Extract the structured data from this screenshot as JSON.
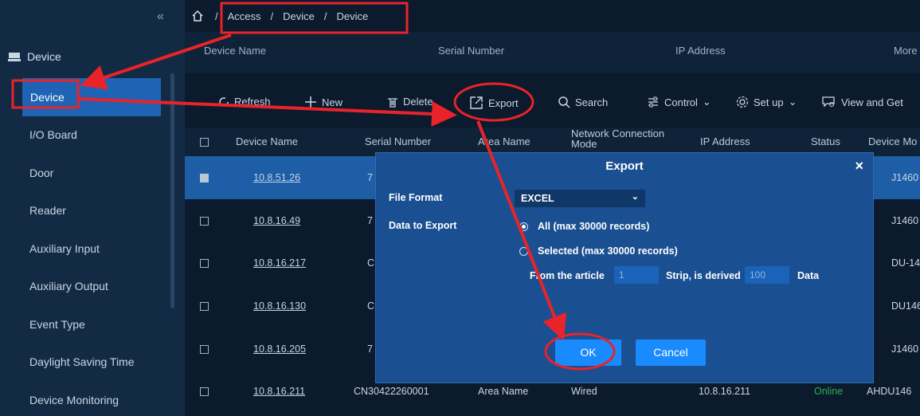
{
  "breadcrumb": [
    "Access",
    "Device",
    "Device"
  ],
  "sidebar": {
    "group_label": "Device",
    "items": [
      {
        "label": "Device",
        "active": true
      },
      {
        "label": "I/O Board"
      },
      {
        "label": "Door"
      },
      {
        "label": "Reader"
      },
      {
        "label": "Auxiliary Input"
      },
      {
        "label": "Auxiliary Output"
      },
      {
        "label": "Event Type"
      },
      {
        "label": "Daylight Saving Time"
      },
      {
        "label": "Device Monitoring"
      }
    ]
  },
  "filter": {
    "device_name": "Device Name",
    "serial_number": "Serial Number",
    "ip_address": "IP Address",
    "more": "More"
  },
  "toolbar": {
    "refresh": "Refresh",
    "new": "New",
    "delete": "Delete",
    "export": "Export",
    "search": "Search",
    "control": "Control",
    "setup": "Set up",
    "view": "View and Get"
  },
  "table": {
    "headers": {
      "device_name": "Device Name",
      "serial_number": "Serial Number",
      "area_name": "Area Name",
      "network_mode_1": "Network Connection",
      "network_mode_2": "Mode",
      "ip_address": "IP Address",
      "status": "Status",
      "device_model": "Device Mo"
    },
    "rows": [
      {
        "name": "10.8.51.26",
        "serial": "7",
        "model": "J1460",
        "checked": true
      },
      {
        "name": "10.8.16.49",
        "serial": "7",
        "model": "J1460"
      },
      {
        "name": "10.8.16.217",
        "serial": "C",
        "model": "DU-146"
      },
      {
        "name": "10.8.16.130",
        "serial": "C",
        "model": "DU146"
      },
      {
        "name": "10.8.16.205",
        "serial": "7",
        "model": "J1460"
      },
      {
        "name": "10.8.16.211",
        "serial": "CN30422260001",
        "area": "Area Name",
        "mode": "Wired",
        "ip": "10.8.16.211",
        "status": "Online",
        "model": "AHDU146"
      }
    ]
  },
  "modal": {
    "title": "Export",
    "close": "×",
    "file_format_label": "File Format",
    "file_format_value": "EXCEL",
    "data_to_export_label": "Data to Export",
    "option_all": "All (max 30000 records)",
    "option_selected": "Selected (max 30000 records)",
    "from_label": "From the article",
    "from_value": "1",
    "strip_label": "Strip, is derived",
    "count_value": "100",
    "data_label": "Data",
    "ok": "OK",
    "cancel": "Cancel"
  },
  "colors": {
    "accent": "#1e63b4",
    "annotation": "#e8232a",
    "online": "#2cae54"
  }
}
